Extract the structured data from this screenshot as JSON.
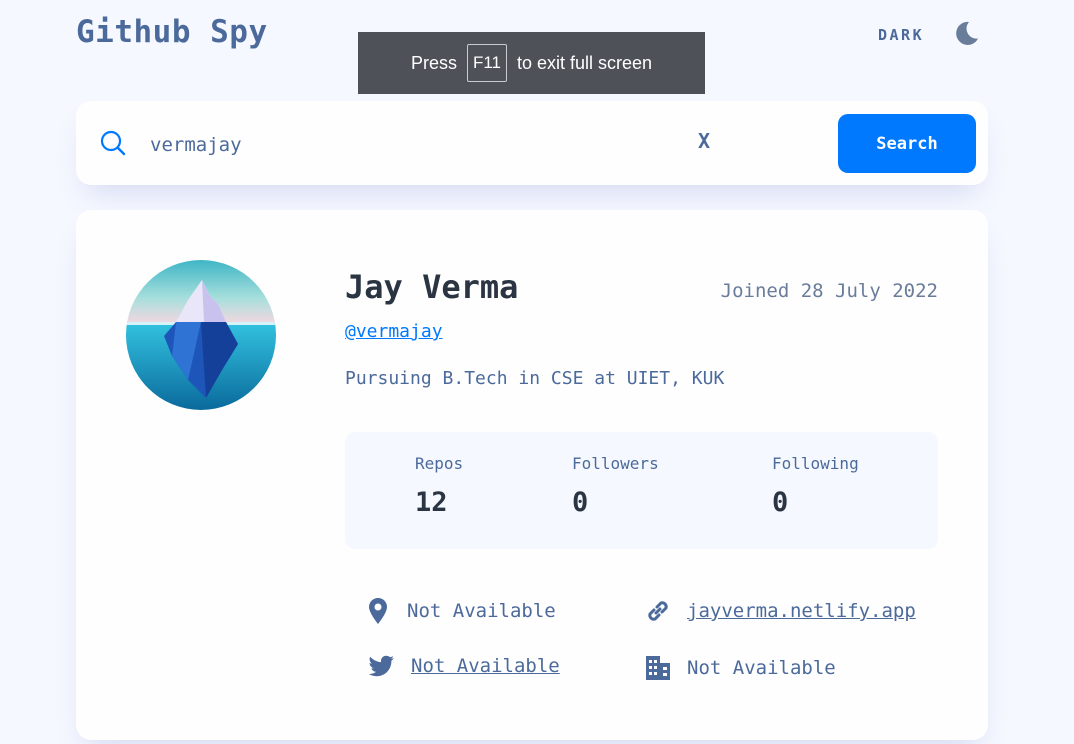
{
  "header": {
    "app_title": "Github Spy",
    "theme_label": "DARK",
    "theme_icon": "moon-icon"
  },
  "fullscreen_notice": {
    "prefix": "Press",
    "key": "F11",
    "suffix": "to exit full screen"
  },
  "search": {
    "value": "vermajay",
    "clear_label": "X",
    "button_label": "Search",
    "icon": "search-icon"
  },
  "profile": {
    "name": "Jay Verma",
    "joined": "Joined 28 July 2022",
    "login": "@vermajay",
    "bio": "Pursuing B.Tech in CSE at UIET, KUK",
    "avatar": "iceberg-avatar",
    "stats": [
      {
        "label": "Repos",
        "value": "12"
      },
      {
        "label": "Followers",
        "value": "0"
      },
      {
        "label": "Following",
        "value": "0"
      }
    ],
    "links": {
      "location": "Not Available",
      "website": "jayverma.netlify.app",
      "twitter": "Not Available",
      "company": "Not Available"
    }
  },
  "colors": {
    "background": "#f6f8ff",
    "accent": "#0079ff",
    "text": "#4b6a9b",
    "heading": "#2b3442",
    "card": "#fefefe"
  }
}
